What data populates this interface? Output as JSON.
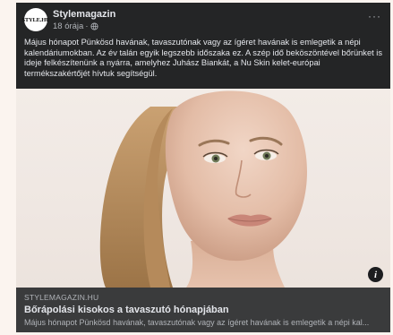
{
  "post": {
    "page_name": "Stylemagazin",
    "logo_text": "STYLE.HU",
    "time": "18 órája",
    "separator": "·",
    "more_label": "···",
    "text": "Május hónapot Pünkösd havának, tavaszutónak vagy az ígéret havának is emlegetik a népi kalendáriumokban. Az év talán egyik legszebb időszaka ez. A szép idő beköszöntével bőrünket is ideje felkészítenünk a nyárra, amelyhez Juhász Biankát, a Nu Skin kelet-európai termékszakértőjét hívtuk segítségül."
  },
  "link": {
    "domain": "STYLEMAGAZIN.HU",
    "title": "Bőrápolási kisokos a tavaszutó hónapjában",
    "description": "Május hónapot Pünkösd havának, tavaszutónak vagy az ígéret havának is emlegetik a népi kal...",
    "info_label": "i"
  },
  "colors": {
    "card_bg": "#242526",
    "link_bg": "#3a3b3c",
    "text_primary": "#e4e6eb",
    "text_secondary": "#b0b3b8"
  }
}
